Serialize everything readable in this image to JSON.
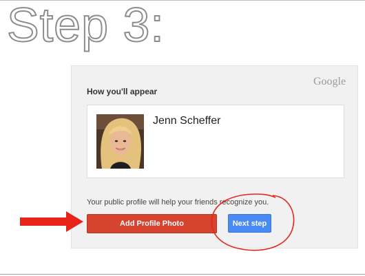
{
  "heading": {
    "text": "Step 3:"
  },
  "panel": {
    "brand": "Google",
    "section_title": "How you'll appear",
    "profile": {
      "name": "Jenn Scheffer"
    },
    "helper_text": "Your public profile will help your friends recognize you.",
    "buttons": {
      "add_photo_label": "Add Profile Photo",
      "next_step_label": "Next step"
    }
  },
  "colors": {
    "add_photo_button": "#d64430",
    "next_step_button": "#4a8af4",
    "annotation": "#e8241a"
  },
  "icons": {
    "annotation_arrow": "arrow-right-icon",
    "annotation_circle": "highlight-circle-icon"
  }
}
